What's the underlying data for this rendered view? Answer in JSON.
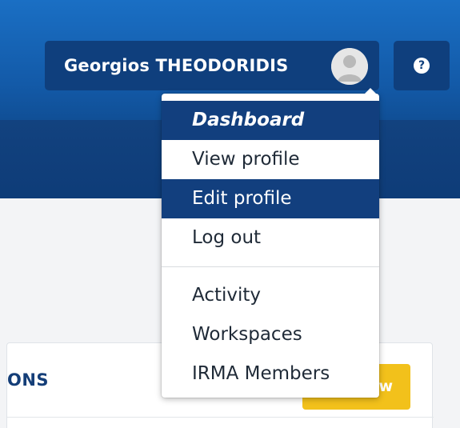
{
  "header": {
    "user_name": "Georgios THEODORIDIS",
    "help_glyph": "?"
  },
  "menu": {
    "primary": [
      {
        "label": "Dashboard",
        "state": "active"
      },
      {
        "label": "View profile",
        "state": "normal"
      },
      {
        "label": "Edit profile",
        "state": "hover"
      },
      {
        "label": "Log out",
        "state": "normal"
      }
    ],
    "secondary": [
      {
        "label": "Activity"
      },
      {
        "label": "Workspaces"
      },
      {
        "label": "IRMA Members"
      }
    ]
  },
  "card": {
    "title_fragment": "ONS",
    "button_fragment": "w"
  },
  "icons": {
    "avatar": "user-avatar-icon",
    "help": "question-icon"
  },
  "colors": {
    "header_blue": "#1a6fc4",
    "dark_blue": "#0f3f7d",
    "accent_yellow": "#f2c11b"
  }
}
